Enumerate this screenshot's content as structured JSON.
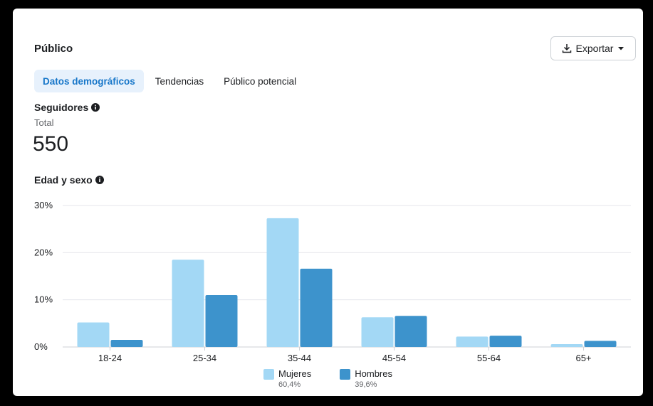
{
  "header": {
    "title": "Público",
    "export_label": "Exportar"
  },
  "tabs": [
    {
      "label": "Datos demográficos",
      "active": true
    },
    {
      "label": "Tendencias",
      "active": false
    },
    {
      "label": "Público potencial",
      "active": false
    }
  ],
  "followers": {
    "title": "Seguidores",
    "total_label": "Total",
    "total_value": "550"
  },
  "age_gender": {
    "title": "Edad y sexo"
  },
  "colors": {
    "mujeres": "#a3d8f5",
    "hombres": "#3d93cc",
    "grid": "#e4e6eb",
    "accent": "#1877c9"
  },
  "legend": [
    {
      "name": "Mujeres",
      "pct": "60,4%",
      "color": "#a3d8f5"
    },
    {
      "name": "Hombres",
      "pct": "39,6%",
      "color": "#3d93cc"
    }
  ],
  "chart_data": {
    "type": "bar",
    "categories": [
      "18-24",
      "25-34",
      "35-44",
      "45-54",
      "55-64",
      "65+"
    ],
    "series": [
      {
        "name": "Mujeres",
        "values": [
          5.2,
          18.5,
          27.3,
          6.3,
          2.2,
          0.6
        ]
      },
      {
        "name": "Hombres",
        "values": [
          1.5,
          11.0,
          16.6,
          6.6,
          2.4,
          1.3
        ]
      }
    ],
    "yticks": [
      "0%",
      "10%",
      "20%",
      "30%"
    ],
    "ylim": [
      0,
      30
    ],
    "grid": true,
    "legend_position": "bottom"
  }
}
